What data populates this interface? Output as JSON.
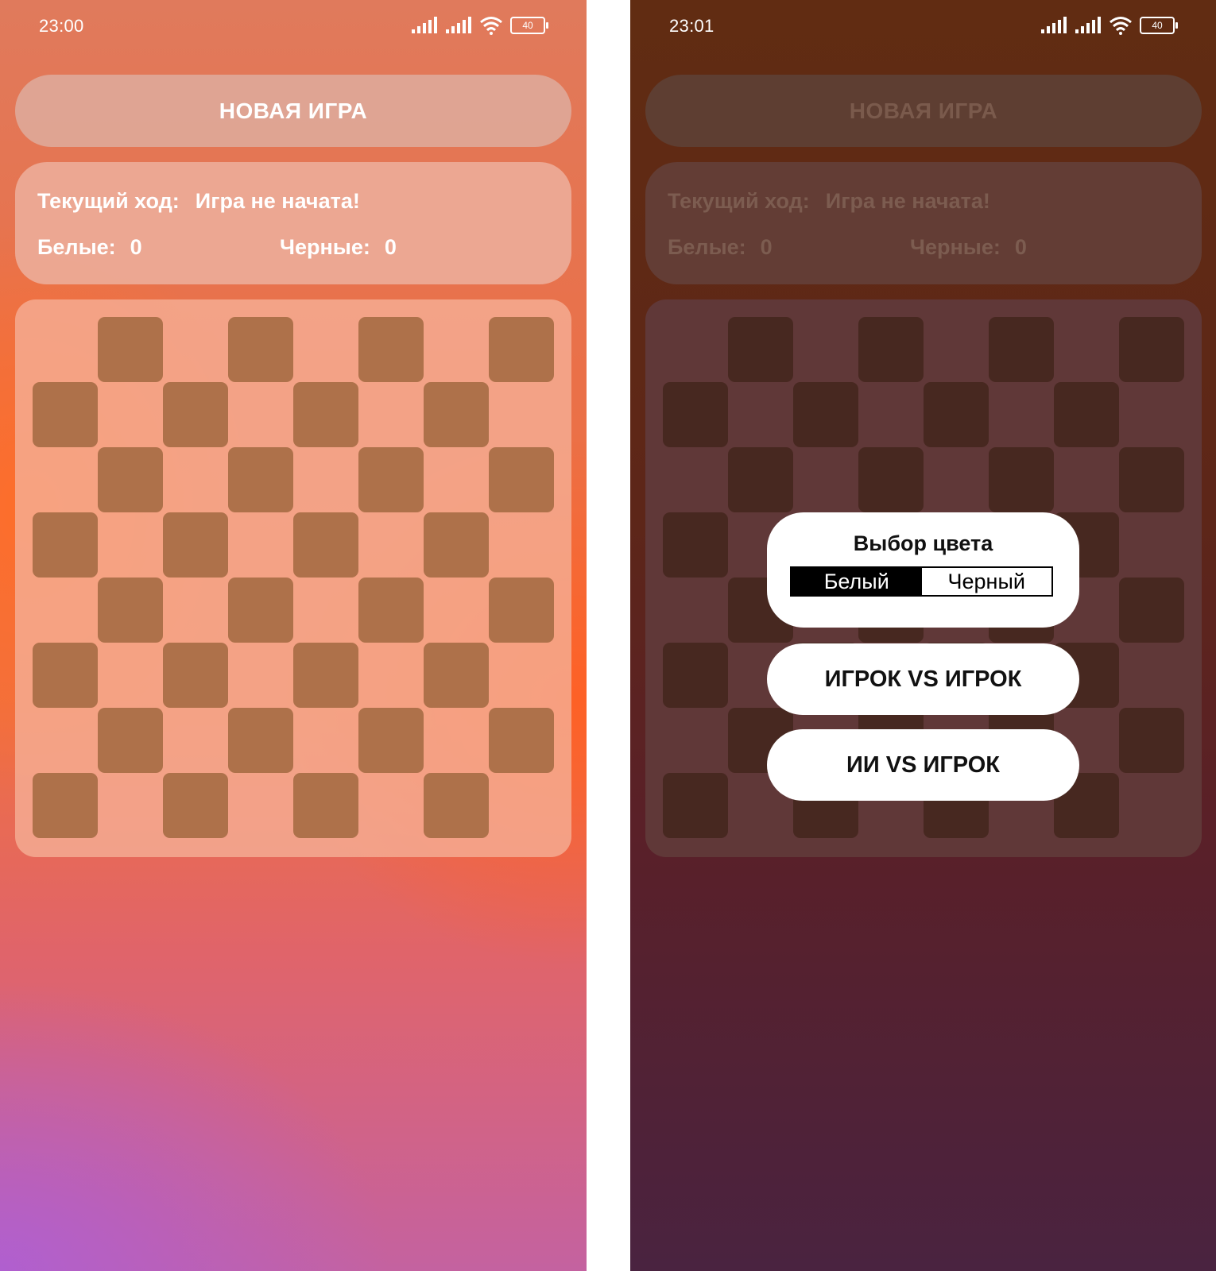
{
  "screens": [
    {
      "status": {
        "time": "23:00",
        "battery": "40"
      },
      "new_game_label": "НОВАЯ ИГРА",
      "info": {
        "turn_label": "Текущий ход:",
        "turn_value": "Игра не начата!",
        "white_label": "Белые:",
        "white_score": "0",
        "black_label": "Черные:",
        "black_score": "0"
      }
    },
    {
      "status": {
        "time": "23:01",
        "battery": "40"
      },
      "new_game_label": "НОВАЯ ИГРА",
      "info": {
        "turn_label": "Текущий ход:",
        "turn_value": "Игра не начата!",
        "white_label": "Белые:",
        "white_score": "0",
        "black_label": "Черные:",
        "black_score": "0"
      },
      "dialog": {
        "title": "Выбор цвета",
        "options": [
          "Белый",
          "Черный"
        ],
        "selected": "Белый",
        "mode_buttons": [
          "ИГРОК VS ИГРОК",
          "ИИ VS ИГРОК"
        ]
      }
    }
  ],
  "colors": {
    "board_dark_cell": "#ae714a",
    "board_dark_cell_dimmed": "#472820",
    "accent_text": "#ffffff",
    "dialog_bg": "#ffffff",
    "segment_active": "#000000"
  },
  "icons": [
    "signal-icon",
    "signal-icon",
    "wifi-icon",
    "battery-icon"
  ]
}
